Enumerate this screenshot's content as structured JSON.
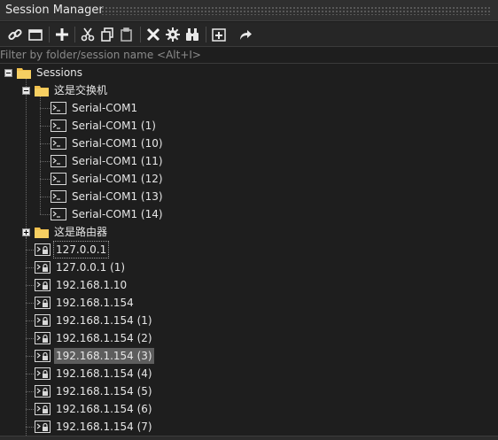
{
  "window": {
    "title": "Session Manager"
  },
  "toolbar": {
    "icons": [
      "link-icon",
      "window-icon",
      "add-icon",
      "cut-icon",
      "copy-icon",
      "paste-icon",
      "delete-icon",
      "gear-icon",
      "binoculars-icon",
      "new-folder-icon",
      "share-icon"
    ]
  },
  "filter": {
    "placeholder": "Filter by folder/session name <Alt+I>",
    "value": ""
  },
  "tree": {
    "root": {
      "label": "Sessions",
      "expanded": true
    },
    "folder1": {
      "label": "这是交换机",
      "expanded": true,
      "items": [
        "Serial-COM1",
        "Serial-COM1 (1)",
        "Serial-COM1 (10)",
        "Serial-COM1 (11)",
        "Serial-COM1 (12)",
        "Serial-COM1 (13)",
        "Serial-COM1 (14)"
      ]
    },
    "folder2": {
      "label": "这是路由器",
      "expanded": false
    },
    "sessions": [
      "127.0.0.1",
      "127.0.0.1 (1)",
      "192.168.1.10",
      "192.168.1.154",
      "192.168.1.154 (1)",
      "192.168.1.154 (2)",
      "192.168.1.154 (3)",
      "192.168.1.154 (4)",
      "192.168.1.154 (5)",
      "192.168.1.154 (6)",
      "192.168.1.154 (7)"
    ],
    "selected": "192.168.1.154 (3)",
    "focused": "127.0.0.1"
  },
  "colors": {
    "folder": "#f2c14e",
    "selection": "#5d5d5d",
    "background": "#1e1e1e"
  }
}
